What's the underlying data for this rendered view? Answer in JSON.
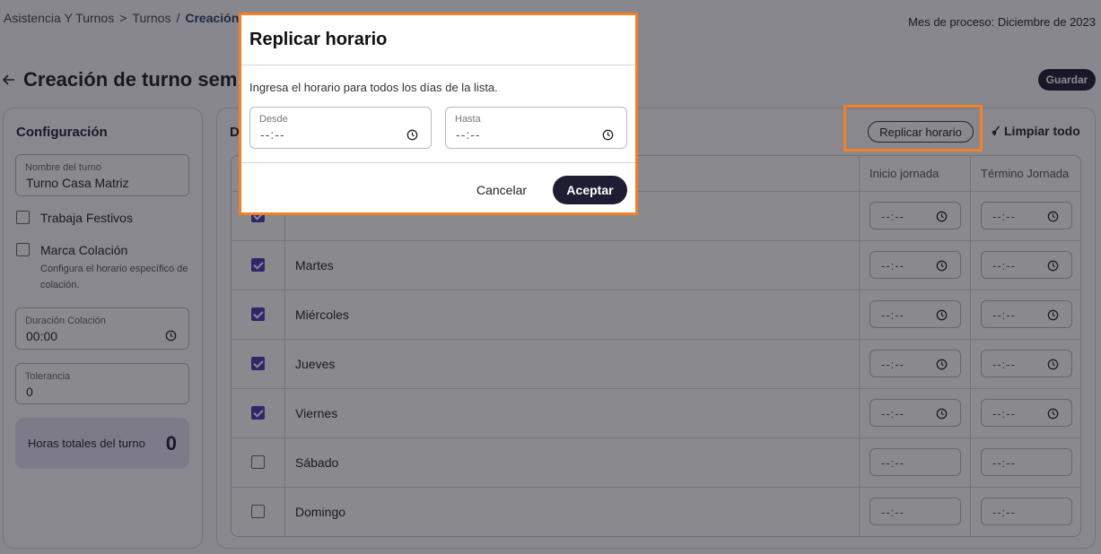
{
  "breadcrumb": {
    "item1": "Asistencia Y Turnos",
    "sep1": ">",
    "item2": "Turnos",
    "sep2": "/",
    "current": "Creación d"
  },
  "header": {
    "month_label": "Mes de proceso: Diciembre de 2023",
    "title": "Creación de turno sem",
    "save_label": "Guardar"
  },
  "config": {
    "title": "Configuración",
    "shift_name_label": "Nombre del turno",
    "shift_name_value": "Turno Casa Matriz",
    "holidays_label": "Trabaja Festivos",
    "meal_label": "Marca Colación",
    "meal_desc": "Configura el horario específico de colación.",
    "meal_duration_label": "Duración Colación",
    "meal_duration_value": "00:00",
    "tolerance_label": "Tolerancia",
    "tolerance_value": "0",
    "total_hours_label": "Horas totales del turno",
    "total_hours_value": "0"
  },
  "days_panel": {
    "title": "D",
    "replicate_label": "Replicar horario",
    "clear_label": "Limpiar todo",
    "col_start": "Inicio jornada",
    "col_end": "Término Jornada",
    "time_placeholder": "--:--",
    "rows": [
      {
        "day": "",
        "checked": true
      },
      {
        "day": "Martes",
        "checked": true
      },
      {
        "day": "Miércoles",
        "checked": true
      },
      {
        "day": "Jueves",
        "checked": true
      },
      {
        "day": "Viernes",
        "checked": true
      },
      {
        "day": "Sábado",
        "checked": false
      },
      {
        "day": "Domingo",
        "checked": false
      }
    ]
  },
  "modal": {
    "title": "Replicar horario",
    "description": "Ingresa el horario para todos los días de la lista.",
    "from_label": "Desde",
    "to_label": "Hasta",
    "time_placeholder": "--:--",
    "cancel_label": "Cancelar",
    "accept_label": "Aceptar"
  },
  "colors": {
    "accent": "#1e1d33",
    "highlight": "#f58025",
    "checkbox": "#4b3ab5"
  },
  "icons": {
    "back": "arrow-left-icon",
    "clock": "clock-icon",
    "broom": "broom-icon"
  }
}
